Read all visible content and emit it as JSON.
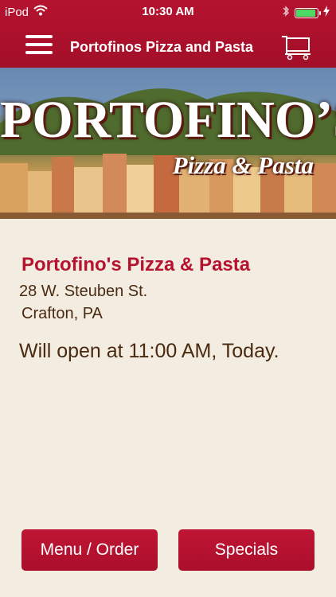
{
  "status_bar": {
    "carrier": "iPod",
    "time": "10:30 AM",
    "icons": [
      "wifi-icon",
      "bluetooth-icon",
      "battery-icon",
      "charging-icon"
    ]
  },
  "nav": {
    "title": "Portofinos Pizza and Pasta",
    "menu_icon": "hamburger-menu-icon",
    "cart_icon": "shopping-cart-icon"
  },
  "banner": {
    "logo_main": "PORTOFINO’S",
    "logo_sub": "Pizza & Pasta"
  },
  "store": {
    "name": "Portofino's Pizza & Pasta",
    "address_line1": "28 W. Steuben St.",
    "address_line2": "Crafton, PA",
    "hours_text": "Will open at 11:00 AM, Today."
  },
  "buttons": {
    "menu_order": "Menu / Order",
    "specials": "Specials"
  },
  "colors": {
    "brand_red": "#b5132f",
    "background": "#f3ece1",
    "text_brown": "#4a2a10",
    "battery_green": "#4cd964"
  }
}
